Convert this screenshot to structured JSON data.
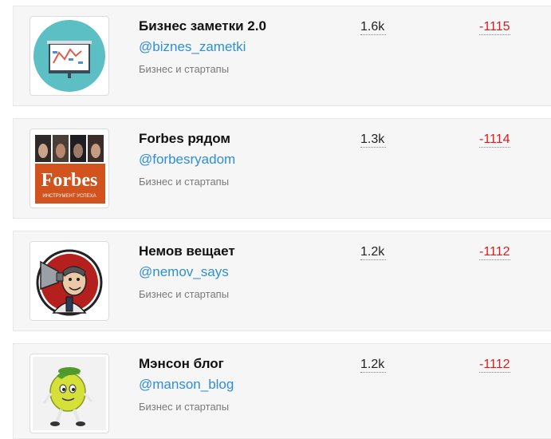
{
  "channels": [
    {
      "title": "Бизнес заметки 2.0",
      "handle": "@biznes_zametki",
      "category": "Бизнес и стартапы",
      "subscribers": "1.6k",
      "delta": "-1115",
      "avatar_icon": "presentation-board-icon"
    },
    {
      "title": "Forbes рядом",
      "handle": "@forbesryadom",
      "category": "Бизнес и стартапы",
      "subscribers": "1.3k",
      "delta": "-1114",
      "avatar_icon": "forbes-logo-icon",
      "avatar_logo_text": "Forbes",
      "avatar_tagline": "ИНСТРУМЕНТ УСПЕХА"
    },
    {
      "title": "Немов вещает",
      "handle": "@nemov_says",
      "category": "Бизнес и стартапы",
      "subscribers": "1.2k",
      "delta": "-1112",
      "avatar_icon": "megaphone-man-icon"
    },
    {
      "title": "Мэнсон блог",
      "handle": "@manson_blog",
      "category": "Бизнес и стартапы",
      "subscribers": "1.2k",
      "delta": "-1112",
      "avatar_icon": "lemon-character-icon"
    }
  ],
  "colors": {
    "handle": "#2d8fd5",
    "delta": "#e01b1b",
    "card_bg": "#f6f6f6",
    "forbes_orange": "#d2531e",
    "teal_circle": "#5bbfc3"
  }
}
